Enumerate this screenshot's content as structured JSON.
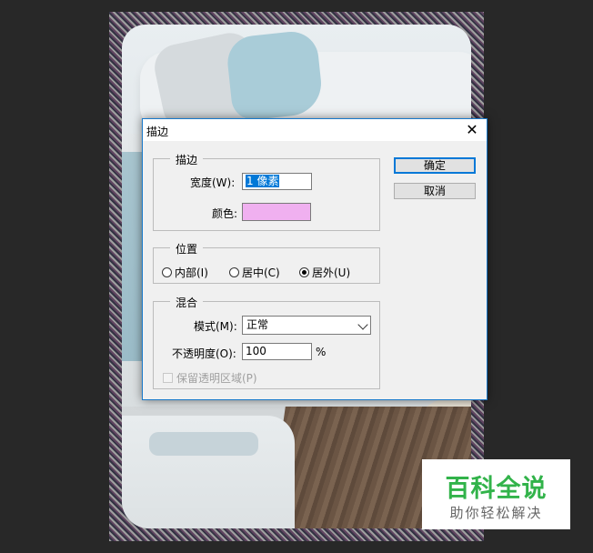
{
  "dialog": {
    "title": "描边",
    "close_glyph": "✕",
    "stroke_group": {
      "legend": "描边",
      "width_label": "宽度(W):",
      "width_value": "1 像素",
      "color_label": "颜色:",
      "color_value": "#f0b0f0"
    },
    "position_group": {
      "legend": "位置",
      "options": [
        {
          "label": "内部(I)",
          "selected": false
        },
        {
          "label": "居中(C)",
          "selected": false
        },
        {
          "label": "居外(U)",
          "selected": true
        }
      ]
    },
    "blend_group": {
      "legend": "混合",
      "mode_label": "模式(M):",
      "mode_value": "正常",
      "opacity_label": "不透明度(O):",
      "opacity_value": "100",
      "opacity_unit": "%",
      "preserve_label": "保留透明区域(P)",
      "preserve_checked": false
    },
    "ok_label": "确定",
    "cancel_label": "取消"
  },
  "watermark": {
    "line1": "百科全说",
    "line2": "助你轻松解决"
  },
  "colors": {
    "accent": "#0078d7",
    "workspace": "#282828",
    "watermark_green": "#32b34a"
  }
}
